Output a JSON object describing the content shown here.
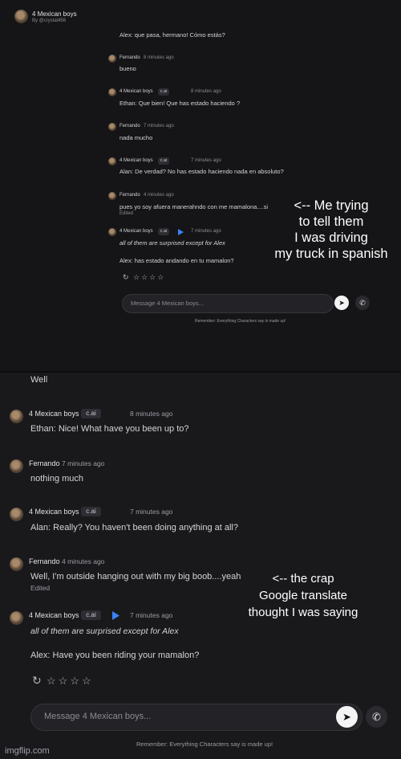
{
  "header": {
    "bot_name": "4 Mexican boys",
    "byline": "By @crystal456"
  },
  "top_chat": {
    "first_line": "Alex: que pasa, hermano! Cómo estás?",
    "messages": [
      {
        "author": "Fernando",
        "badge": "",
        "time": "8 minutes ago",
        "lines": [
          "bueno"
        ]
      },
      {
        "author": "4 Mexican boys",
        "badge": "c.ai",
        "time": "8 minutes ago",
        "lines": [
          "Ethan: Que bien! Que has estado haciendo ?"
        ]
      },
      {
        "author": "Fernando",
        "badge": "",
        "time": "7 minutes ago",
        "lines": [
          "nada mucho"
        ]
      },
      {
        "author": "4 Mexican boys",
        "badge": "c.ai",
        "time": "7 minutes ago",
        "lines": [
          "Alan: De verdad? No has estado haciendo nada en absoluto?"
        ]
      },
      {
        "author": "Fernando",
        "badge": "",
        "time": "4 minutes ago",
        "lines": [
          "pues yo  soy afuera manerahndo con me mamalona....si"
        ],
        "edited": "Edited"
      },
      {
        "author": "4 Mexican boys",
        "badge": "c.ai",
        "time": "7 minutes ago",
        "lines": [
          "all of them are surprised except for Alex",
          "Alex: has estado andando en tu mamalon?"
        ]
      }
    ],
    "input_placeholder": "Message 4 Mexican boys...",
    "disclaimer": "Remember: Everything Characters say is made up!"
  },
  "bottom_chat": {
    "first_line": "Well",
    "messages": [
      {
        "author": "4 Mexican boys",
        "badge": "c.ai",
        "time": "8 minutes ago",
        "lines": [
          "Ethan: Nice! What have you been up to?"
        ]
      },
      {
        "author": "Fernando",
        "badge": "",
        "time": "7 minutes ago",
        "lines": [
          "nothing much"
        ]
      },
      {
        "author": "4 Mexican boys",
        "badge": "c.ai",
        "time": "7 minutes ago",
        "lines": [
          "Alan: Really? You haven't been doing anything at all?"
        ]
      },
      {
        "author": "Fernando",
        "badge": "",
        "time": "4 minutes ago",
        "lines": [
          "Well, I'm outside hanging out with my big boob....yeah"
        ],
        "edited": "Edited"
      },
      {
        "author": "4 Mexican boys",
        "badge": "c.ai",
        "time": "7 minutes ago",
        "lines": [
          "all of them are surprised except for Alex",
          "Alex: Have you been riding your mamalon?"
        ]
      }
    ],
    "input_placeholder": "Message 4 Mexican boys...",
    "disclaimer": "Remember: Everything Characters say is made up!"
  },
  "captions": {
    "top": [
      "<-- Me trying",
      "to tell them",
      "I was driving",
      "my truck in spanish"
    ],
    "bottom": [
      "<-- the crap",
      "Google translate",
      "thought I was saying"
    ]
  },
  "watermark": "imgflip.com",
  "icons": {
    "refresh": "refresh-icon",
    "star": "star-icon",
    "send": "send-icon",
    "phone": "phone-icon",
    "translate": "translate-icon"
  },
  "colors": {
    "accent_blue": "#3b82f6"
  }
}
